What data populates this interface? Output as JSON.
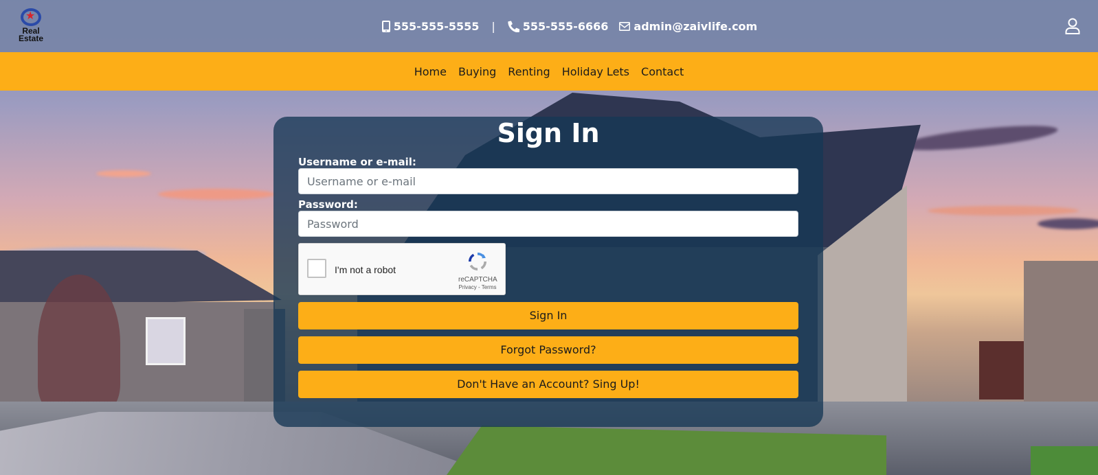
{
  "brand": {
    "logo_line1": "Real",
    "logo_line2": "Estate"
  },
  "contacts": {
    "mobile": "555-555-5555",
    "separator": "|",
    "phone": "555-555-6666",
    "email": "admin@zaivlife.com"
  },
  "nav": {
    "items": [
      "Home",
      "Buying",
      "Renting",
      "Holiday Lets",
      "Contact"
    ]
  },
  "signin": {
    "title": "Sign In",
    "username_label": "Username or e-mail:",
    "username_placeholder": "Username or e-mail",
    "password_label": "Password:",
    "password_placeholder": "Password",
    "captcha_text": "I'm not a robot",
    "captcha_brand": "reCAPTCHA",
    "captcha_links": "Privacy - Terms",
    "signin_button": "Sign In",
    "forgot_button": "Forgot Password?",
    "signup_button": "Don't Have an Account? Sing Up!"
  },
  "colors": {
    "accent": "#fdae17",
    "card": "#163754",
    "topbar": "#7886a8"
  },
  "icons": {
    "logo": "real-estate-logo",
    "mobile": "mobile-phone-icon",
    "phone": "phone-icon",
    "email": "envelope-icon",
    "user": "user-icon",
    "captcha": "recaptcha-icon"
  }
}
